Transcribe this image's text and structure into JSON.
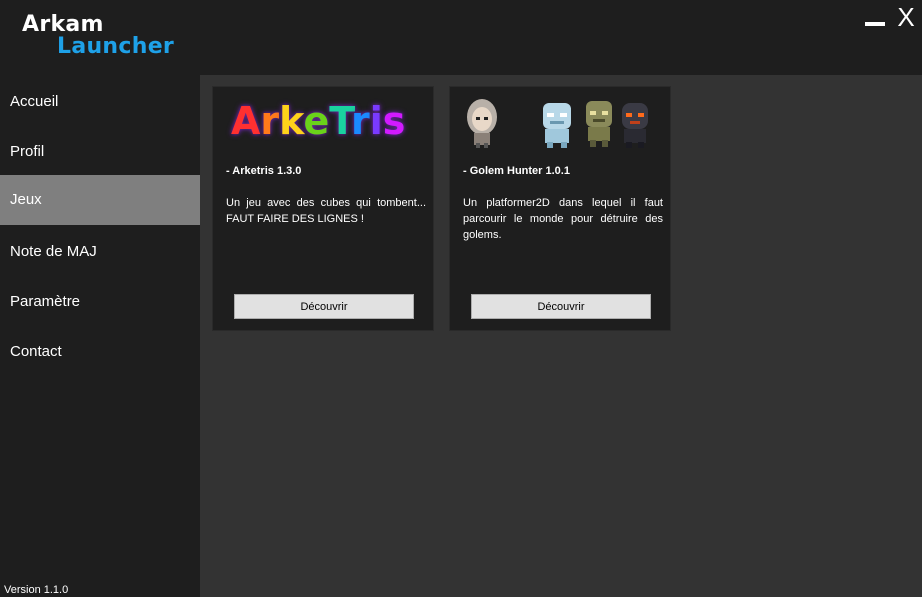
{
  "header": {
    "logo_line1": "Arkam",
    "logo_line2": "Launcher",
    "minimize_label": "",
    "close_label": "X"
  },
  "sidebar": {
    "items": [
      {
        "label": "Accueil"
      },
      {
        "label": "Profil"
      },
      {
        "label": "Jeux"
      },
      {
        "label": "Note de MAJ"
      },
      {
        "label": "Paramètre"
      },
      {
        "label": "Contact"
      }
    ],
    "active_index": 2,
    "version": "Version 1.1.0"
  },
  "games": [
    {
      "logo_text": "ArkeTris",
      "title": "- Arketris 1.3.0",
      "description": "Un jeu avec des cubes qui tombent... FAUT FAIRE DES LIGNES !",
      "button_label": "Découvrir"
    },
    {
      "title": "- Golem Hunter 1.0.1",
      "description": "Un platformer2D dans lequel il faut parcourir le monde pour détruire des golems.",
      "button_label": "Découvrir"
    }
  ],
  "colors": {
    "background": "#1e1e1e",
    "content": "#333333",
    "accent": "#1ea1e8",
    "active_nav": "#7f7f7f"
  }
}
